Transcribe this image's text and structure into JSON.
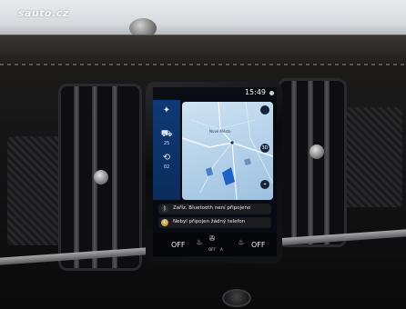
{
  "watermark": "sauto.cz",
  "screen": {
    "clock": "15:49",
    "sidebar": {
      "compass_icon": "compass-icon",
      "item1_icon": "car-icon",
      "item1_label": "25",
      "item2_icon": "route-icon",
      "item2_label": "02"
    },
    "map": {
      "place_label": "Nové Město",
      "button_top": "",
      "button_mid": "3D",
      "button_bottom": "⌖"
    },
    "notifications": [
      {
        "icon": "bluetooth-icon",
        "text": "Zaříz. Bluetooth není připojeno"
      },
      {
        "icon": "phone-icon",
        "text": "Nebyl připojen žádný telefon"
      }
    ],
    "climate": {
      "left_off": "OFF",
      "right_off": "OFF",
      "center_off": "OFF",
      "center_sub": "A"
    }
  },
  "colors": {
    "sidebar": "#0f3a76",
    "map": "#b8d4ea",
    "screen_bg": "#060a12"
  }
}
